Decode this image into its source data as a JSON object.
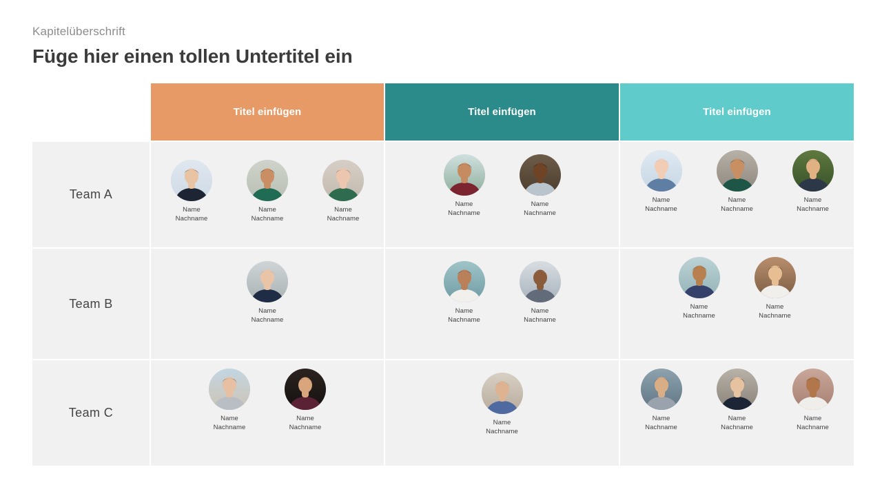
{
  "slide": {
    "eyebrow": "Kapitelüberschrift",
    "title": "Füge hier einen tollen Untertitel ein"
  },
  "colors": {
    "column_1": "#e89a66",
    "column_2": "#2b8a8a",
    "column_3": "#5fcbcb",
    "cell_background": "#f1f1f1",
    "slide_background": "#ffffff",
    "eyebrow_text": "#8c8c8c",
    "title_text": "#3b3b3b",
    "row_label_text": "#444444",
    "name_text": "#3f3f3f",
    "header_text": "#ffffff"
  },
  "columns": [
    {
      "label": "Titel einfügen",
      "color": "#e89a66"
    },
    {
      "label": "Titel einfügen",
      "color": "#2b8a8a"
    },
    {
      "label": "Titel einfügen",
      "color": "#5fcbcb"
    }
  ],
  "rows": [
    {
      "label": "Team A",
      "cells": [
        {
          "align": "variant-down",
          "people": [
            {
              "name": "Name\nNachname",
              "skin": "#e8c3a4",
              "hair": "#2f2317",
              "outfit": "#1d2433",
              "bg_top": "#dfe7ef",
              "bg_bottom": "#cfdae6"
            },
            {
              "name": "Name\nNachname",
              "skin": "#c98e63",
              "hair": "#241a12",
              "outfit": "#1f6b54",
              "bg_top": "#cfd3cb",
              "bg_bottom": "#b9bfb5"
            },
            {
              "name": "Name\nNachname",
              "skin": "#ecc6ae",
              "hair": "#8b3a1e",
              "outfit": "#2f6b4e",
              "bg_top": "#d7cfc6",
              "bg_bottom": "#c2b8ad"
            }
          ]
        },
        {
          "align": "",
          "people": [
            {
              "name": "Name\nNachname",
              "skin": "#c68b60",
              "hair": "#1d140d",
              "outfit": "#7c2430",
              "bg_top": "#cfe0df",
              "bg_bottom": "#8fae9c"
            },
            {
              "name": "Name\nNachname",
              "skin": "#6e4326",
              "hair": "#140d08",
              "outfit": "#b9c4cc",
              "bg_top": "#6d5c48",
              "bg_bottom": "#4a3c2d"
            }
          ]
        },
        {
          "align": "variant-up",
          "people": [
            {
              "name": "Name\nNachname",
              "skin": "#f0cdb4",
              "hair": "#f09bb0",
              "outfit": "#5f7ea3",
              "bg_top": "#dfe9f2",
              "bg_bottom": "#c6d7e4"
            },
            {
              "name": "Name\nNachname",
              "skin": "#c78f62",
              "hair": "#231812",
              "outfit": "#1d5646",
              "bg_top": "#b7b0a6",
              "bg_bottom": "#8e8880"
            },
            {
              "name": "Name\nNachname",
              "skin": "#e0b183",
              "hair": "#120d09",
              "outfit": "#2c3748",
              "bg_top": "#5f7a3f",
              "bg_bottom": "#38502a"
            }
          ]
        }
      ]
    },
    {
      "label": "Team B",
      "cells": [
        {
          "align": "",
          "people": [
            {
              "name": "Name\nNachname",
              "skin": "#eac4a6",
              "hair": "#b9a790",
              "outfit": "#1f2c46",
              "bg_top": "#cfd5d6",
              "bg_bottom": "#a9b1b3"
            }
          ]
        },
        {
          "align": "",
          "people": [
            {
              "name": "Name\nNachname",
              "skin": "#b9805a",
              "hair": "#2a1a12",
              "outfit": "#f2f0ec",
              "bg_top": "#9fc4c8",
              "bg_bottom": "#6f9ba3"
            },
            {
              "name": "Name\nNachname",
              "skin": "#8a5c3c",
              "hair": "#d7d2cb",
              "outfit": "#616b7a",
              "bg_top": "#d8dde2",
              "bg_bottom": "#a7b2bb"
            }
          ]
        },
        {
          "align": "variant-up",
          "people": [
            {
              "name": "Name\nNachname",
              "skin": "#b8804f",
              "hair": "#3a2415",
              "outfit": "#35406b",
              "bg_top": "#bcd3d6",
              "bg_bottom": "#93b2b6"
            },
            {
              "name": "Name\nNachname",
              "skin": "#e7bd92",
              "hair": "#120c08",
              "outfit": "#f1efec",
              "bg_top": "#b98f6d",
              "bg_bottom": "#7d5d44"
            }
          ]
        }
      ]
    },
    {
      "label": "Team C",
      "cells": [
        {
          "align": "variant-up",
          "people": [
            {
              "name": "Name\nNachname",
              "skin": "#e7bfa2",
              "hair": "#4a3322",
              "outfit": "#b9bec4",
              "bg_top": "#c3d6e2",
              "bg_bottom": "#cdc4b4"
            },
            {
              "name": "Name\nNachname",
              "skin": "#d8a57c",
              "hair": "#3a2318",
              "outfit": "#5b2236",
              "bg_top": "#2b2320",
              "bg_bottom": "#15110f"
            }
          ]
        },
        {
          "align": "",
          "people": [
            {
              "name": "Name\nNachname",
              "skin": "#ddb391",
              "hair": "#9e9a96",
              "outfit": "#4f6aa0",
              "bg_top": "#d8d0c4",
              "bg_bottom": "#b6aa9b"
            }
          ]
        },
        {
          "align": "variant-up",
          "people": [
            {
              "name": "Name\nNachname",
              "skin": "#d9ad86",
              "hair": "#4d4a47",
              "outfit": "#9aa3ad",
              "bg_top": "#8ea2ae",
              "bg_bottom": "#5f7684"
            },
            {
              "name": "Name\nNachname",
              "skin": "#e7c2a0",
              "hair": "#15100c",
              "outfit": "#1c2536",
              "bg_top": "#b9b2a8",
              "bg_bottom": "#8a8279"
            },
            {
              "name": "Name\nNachname",
              "skin": "#b2764b",
              "hair": "#241710",
              "outfit": "#f0eeea",
              "bg_top": "#c9a79a",
              "bg_bottom": "#a67f72"
            }
          ]
        }
      ]
    }
  ]
}
